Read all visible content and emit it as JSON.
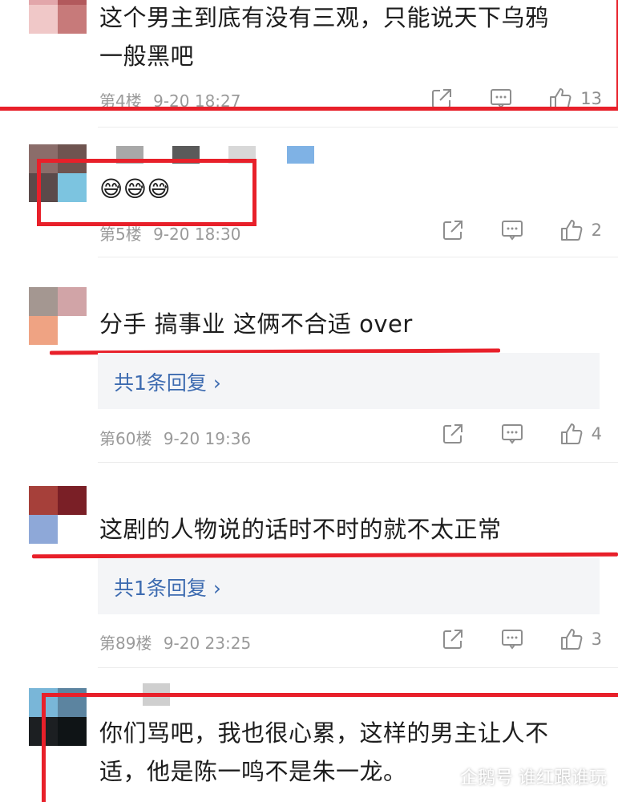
{
  "comments": [
    {
      "text_line1": "这个男主到底有没有三观，只能说天下乌鸦",
      "text_line2": "一般黑吧",
      "floor": "第4楼",
      "time": "9-20 18:27",
      "likes": "13"
    },
    {
      "text_line1": "😅😅😅",
      "floor": "第5楼",
      "time": "9-20 18:30",
      "likes": "2"
    },
    {
      "text_line1": "分手 搞事业 这俩不合适 over",
      "reply_label": "共1条回复 ›",
      "floor": "第60楼",
      "time": "9-20 19:36",
      "likes": "4"
    },
    {
      "text_line1": "这剧的人物说的话时不时的就不太正常",
      "reply_label": "共1条回复 ›",
      "floor": "第89楼",
      "time": "9-20 23:25",
      "likes": "3"
    },
    {
      "text_line1": "你们骂吧，我也很心累，这样的男主让人不",
      "text_line2": "适，他是陈一鸣不是朱一龙。"
    }
  ],
  "watermark": "企鹅号 谁红跟谁玩",
  "colors": {
    "highlight": "#e8202a",
    "reply_link": "#3d6bb0",
    "meta": "#9a9a9a"
  }
}
